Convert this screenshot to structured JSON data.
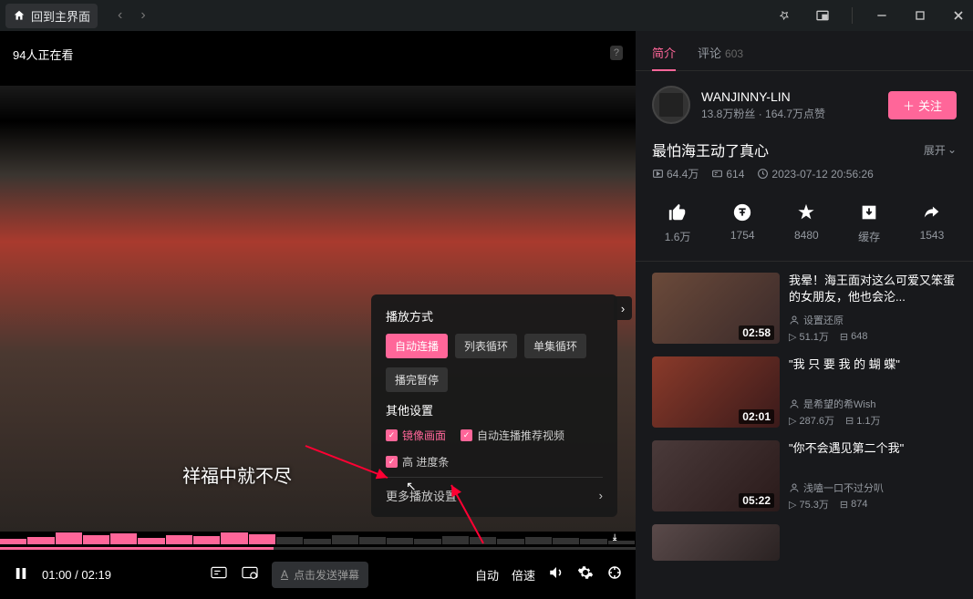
{
  "titlebar": {
    "home": "回到主界面"
  },
  "player": {
    "viewers": "94人正在看",
    "subtitle": "祥福中就不尽",
    "current_time": "01:00",
    "duration": "02:19",
    "time_sep": " / ",
    "danmu_placeholder": "点击发送弹幕",
    "quality": "自动",
    "speed": "倍速"
  },
  "popup": {
    "play_mode_title": "播放方式",
    "modes": [
      "自动连播",
      "列表循环",
      "单集循环"
    ],
    "modes2": [
      "播完暂停"
    ],
    "other_title": "其他设置",
    "mirror": "镜像画面",
    "auto_rec": "自动连播推荐视频",
    "hq_progress": "高    进度条",
    "more": "更多播放设置"
  },
  "tabs": {
    "intro": "简介",
    "comments": "评论",
    "comment_count": "603"
  },
  "author": {
    "name": "WANJINNY-LIN",
    "stats": "13.8万粉丝 · 164.7万点赞",
    "follow": "关注"
  },
  "video": {
    "title": "最怕海王动了真心",
    "expand": "展开",
    "views": "64.4万",
    "danmu": "614",
    "date": "2023-07-12 20:56:26"
  },
  "actions": {
    "like": "1.6万",
    "coin": "1754",
    "fav": "8480",
    "cache": "缓存",
    "share": "1543"
  },
  "related": [
    {
      "title": "我晕！海王面对这么可爱又笨蛋的女朋友，他也会沦...",
      "author": "设置还原",
      "views": "51.1万",
      "danmu": "648",
      "dur": "02:58",
      "quoted": false
    },
    {
      "title": "我 只 要 我 的 蝴 蝶",
      "author": "是希望的希Wish",
      "views": "287.6万",
      "danmu": "1.1万",
      "dur": "02:01",
      "quoted": true
    },
    {
      "title": "你不会遇见第二个我",
      "author": "浅嗑一口不过分叭",
      "views": "75.3万",
      "danmu": "874",
      "dur": "05:22",
      "quoted": true
    }
  ]
}
